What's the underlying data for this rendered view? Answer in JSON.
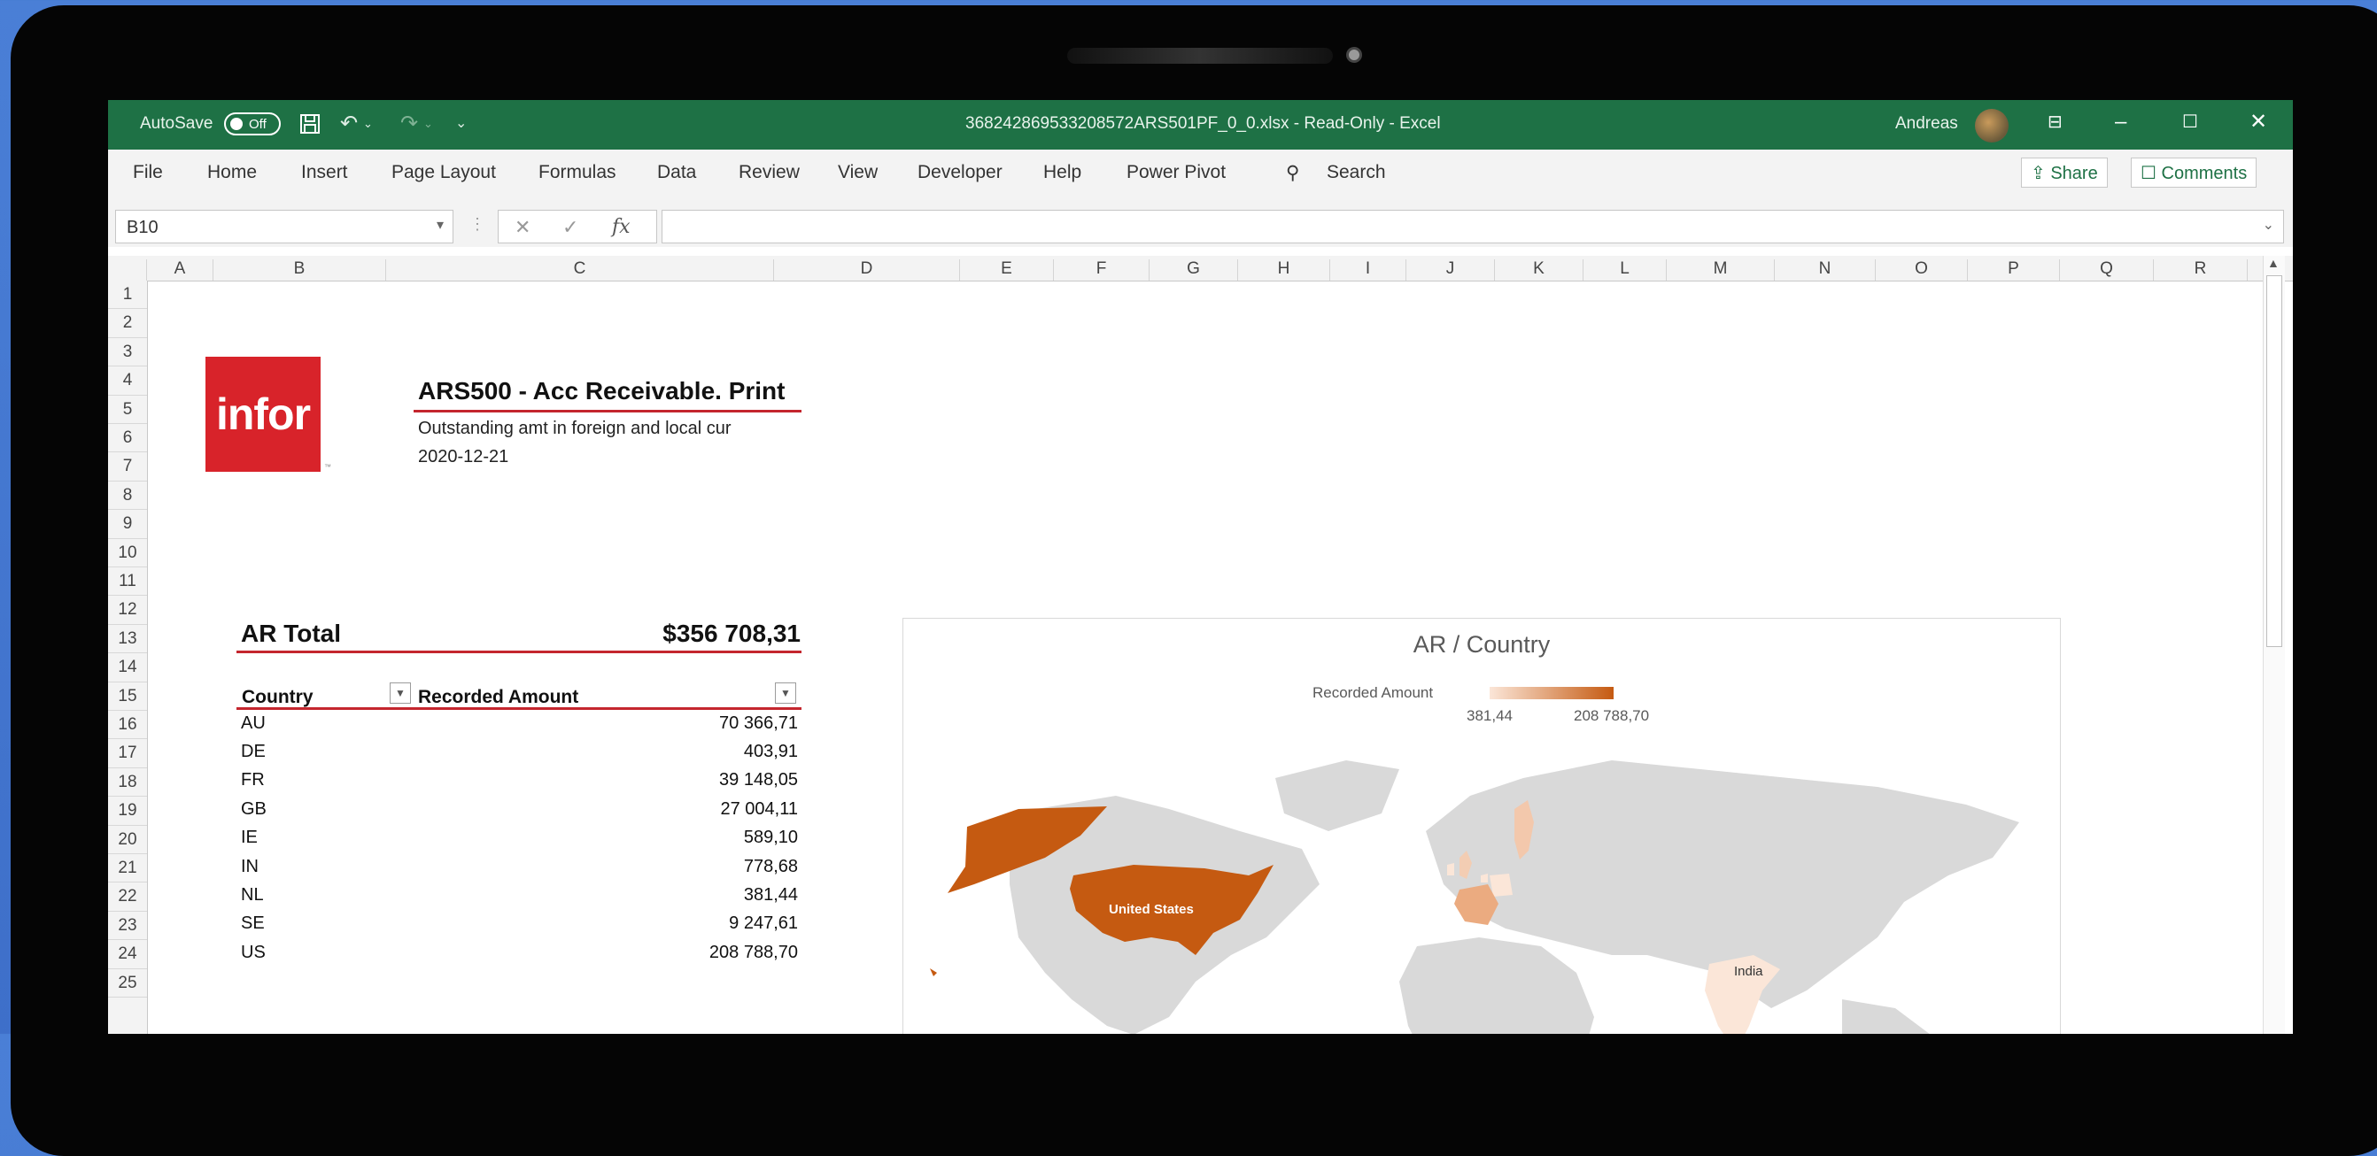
{
  "window": {
    "autosave_label": "AutoSave",
    "autosave_state": "Off",
    "file_title": "368242869533208572ARS501PF_0_0.xlsx  -  Read-Only  -  Excel",
    "user_name": "Andreas"
  },
  "ribbon": {
    "tabs": [
      "File",
      "Home",
      "Insert",
      "Page Layout",
      "Formulas",
      "Data",
      "Review",
      "View",
      "Developer",
      "Help",
      "Power Pivot"
    ],
    "search_label": "Search",
    "share_label": "Share",
    "comments_label": "Comments"
  },
  "formula_bar": {
    "name_box": "B10",
    "formula": ""
  },
  "grid": {
    "columns": [
      "A",
      "B",
      "C",
      "D",
      "E",
      "F",
      "G",
      "H",
      "I",
      "J",
      "K",
      "L",
      "M",
      "N",
      "O",
      "P",
      "Q",
      "R"
    ],
    "rows": [
      "1",
      "2",
      "3",
      "4",
      "5",
      "6",
      "7",
      "8",
      "9",
      "10",
      "11",
      "12",
      "13",
      "14",
      "15",
      "16",
      "17",
      "18",
      "19",
      "20",
      "21",
      "22",
      "23",
      "24",
      "25"
    ]
  },
  "report": {
    "logo_text": "infor",
    "logo_tm": "™",
    "title": "ARS500 - Acc Receivable. Print",
    "subtitle": "Outstanding amt in foreign and local cur",
    "date": "2020-12-21",
    "ar_total_label": "AR Total",
    "ar_total_value": "$356 708,31",
    "table_headers": {
      "country": "Country",
      "amount": "Recorded Amount"
    },
    "rows": [
      {
        "country": "AU",
        "amount": "70 366,71"
      },
      {
        "country": "DE",
        "amount": "403,91"
      },
      {
        "country": "FR",
        "amount": "39 148,05"
      },
      {
        "country": "GB",
        "amount": "27 004,11"
      },
      {
        "country": "IE",
        "amount": "589,10"
      },
      {
        "country": "IN",
        "amount": "778,68"
      },
      {
        "country": "NL",
        "amount": "381,44"
      },
      {
        "country": "SE",
        "amount": "9 247,61"
      },
      {
        "country": "US",
        "amount": "208 788,70"
      }
    ]
  },
  "chart": {
    "title": "AR / Country",
    "legend_label": "Recorded Amount",
    "legend_min": "381,44",
    "legend_max": "208 788,70",
    "label_us": "United States",
    "label_india": "India"
  },
  "colors": {
    "excel_green": "#1e7145",
    "infor_red": "#d8232a",
    "accent_line": "#c4262e",
    "map_high": "#c55a11",
    "map_low": "#fbe6d8",
    "map_land": "#d9d9d9"
  }
}
